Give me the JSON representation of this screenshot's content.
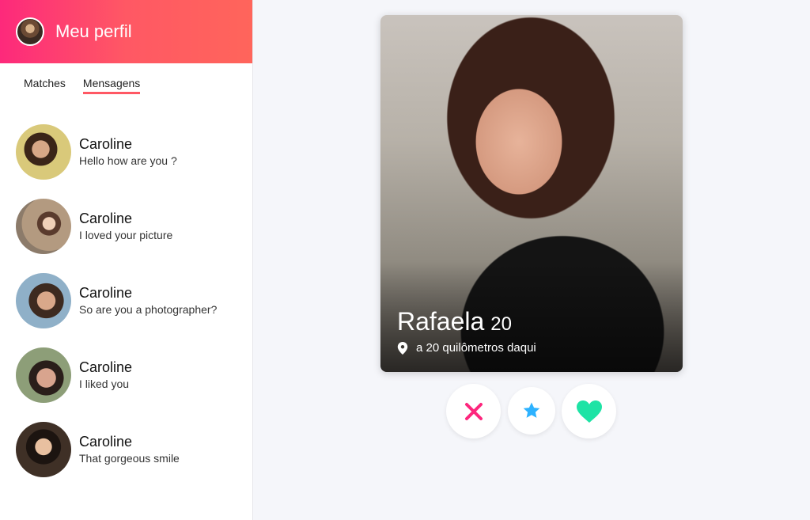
{
  "sidebar": {
    "header": {
      "title": "Meu perfil"
    },
    "tabs": [
      {
        "label": "Matches",
        "active": false
      },
      {
        "label": "Mensagens",
        "active": true
      }
    ],
    "conversations": [
      {
        "name": "Caroline",
        "message": "Hello how are you ?"
      },
      {
        "name": "Caroline",
        "message": "I loved your picture"
      },
      {
        "name": "Caroline",
        "message": "So are you a photographer?"
      },
      {
        "name": "Caroline",
        "message": "I liked you"
      },
      {
        "name": "Caroline",
        "message": "That gorgeous smile"
      }
    ]
  },
  "card": {
    "name": "Rafaela",
    "age": "20",
    "distance": "a 20 quilômetros daqui"
  },
  "actions": {
    "nope_icon": "close-icon",
    "super_like_icon": "star-icon",
    "like_icon": "heart-icon"
  },
  "colors": {
    "brand_gradient_start": "#fd297b",
    "brand_gradient_end": "#ff655b",
    "tab_underline": "#ff5864",
    "nope": "#fd267d",
    "super_like": "#2db2ff",
    "like": "#1ee3a5"
  }
}
